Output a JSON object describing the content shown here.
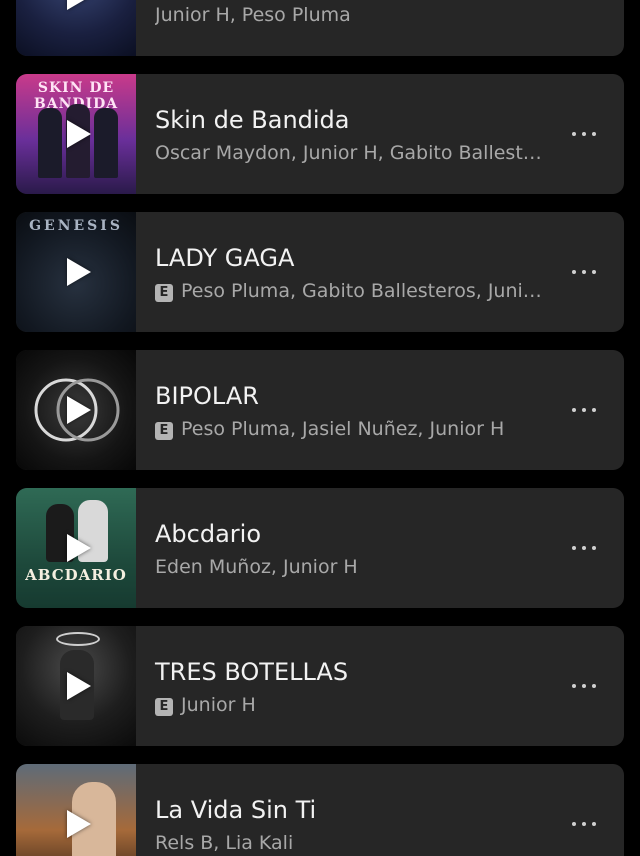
{
  "tracks": [
    {
      "title": "",
      "artists": "Junior H, Peso Pluma",
      "explicit": false,
      "art_text": ""
    },
    {
      "title": "Skin de Bandida",
      "artists": "Oscar Maydon, Junior H, Gabito Ballesteros",
      "explicit": false,
      "art_text": "SKIN DE BANDIDA"
    },
    {
      "title": "LADY GAGA",
      "artists": "Peso Pluma, Gabito Ballesteros, Junior H",
      "explicit": true,
      "art_text": "GENESIS"
    },
    {
      "title": "BIPOLAR",
      "artists": "Peso Pluma, Jasiel Nuñez, Junior H",
      "explicit": true,
      "art_text": ""
    },
    {
      "title": "Abcdario",
      "artists": "Eden Muñoz, Junior H",
      "explicit": false,
      "art_text": "ABCDARIO"
    },
    {
      "title": "TRES BOTELLAS",
      "artists": "Junior H",
      "explicit": true,
      "art_text": ""
    },
    {
      "title": "La Vida Sin Ti",
      "artists": "Rels B, Lia Kali",
      "explicit": false,
      "art_text": ""
    }
  ],
  "explicit_badge": "E",
  "colors": {
    "background": "#000000",
    "card": "#262626",
    "title": "#f2f2f2",
    "subtitle": "#a8a8a8"
  }
}
